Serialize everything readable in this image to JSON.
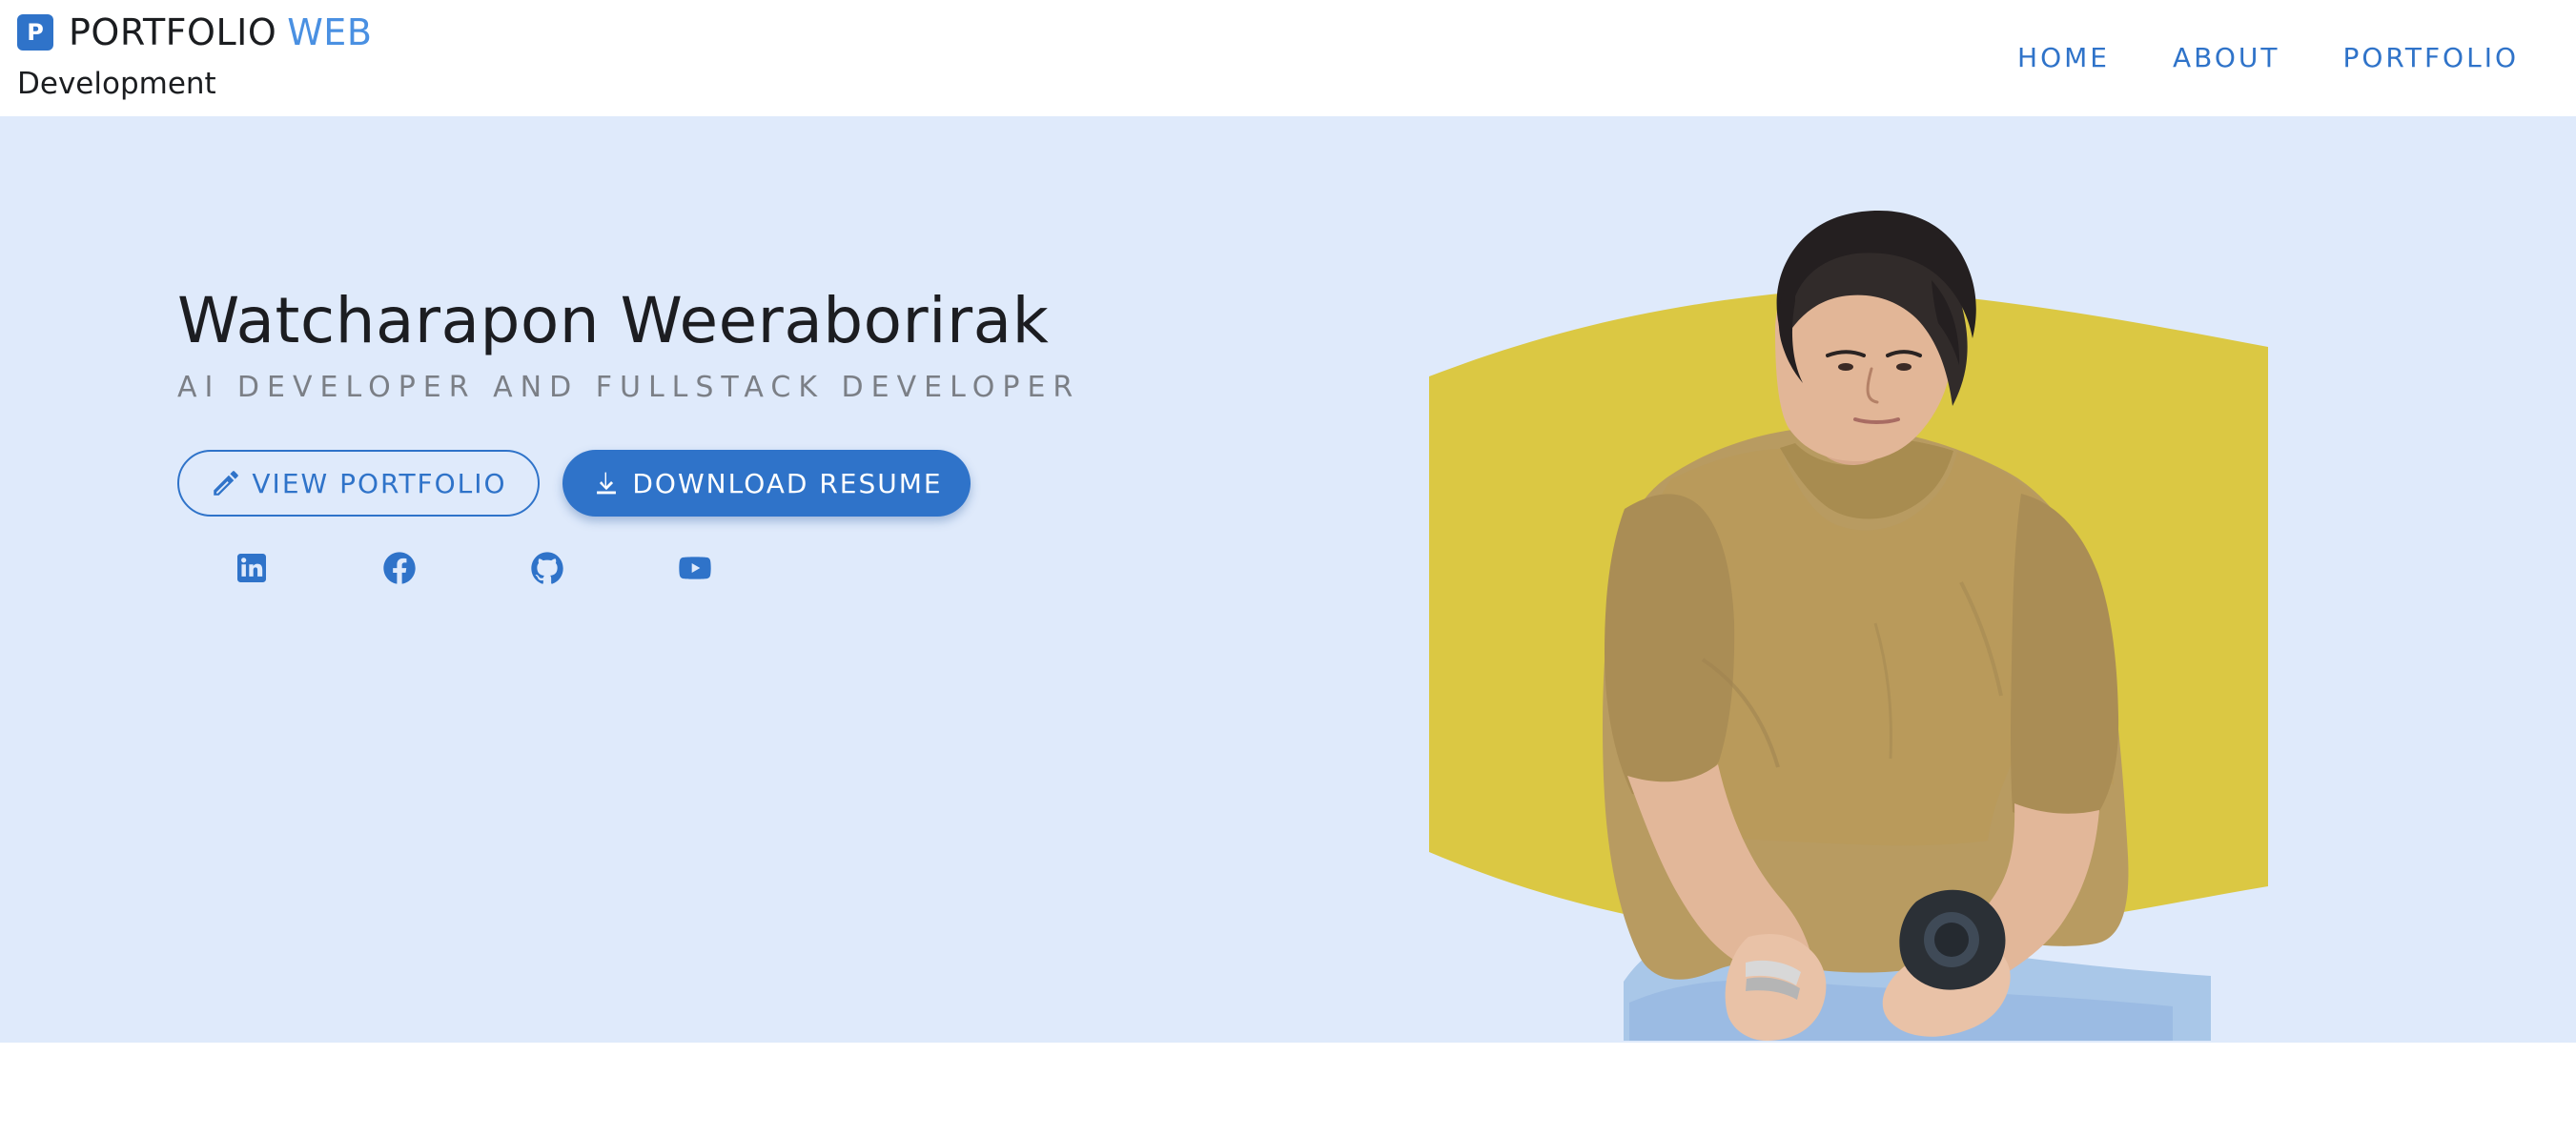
{
  "brand": {
    "icon_letter": "P",
    "primary": "PORTFOLIO",
    "accent": "WEB",
    "subtitle": "Development"
  },
  "nav": {
    "items": [
      "HOME",
      "ABOUT",
      "PORTFOLIO"
    ]
  },
  "hero": {
    "name": "Watcharapon Weeraborirak",
    "tagline": "AI DEVELOPER AND FULLSTACK DEVELOPER",
    "buttons": {
      "view_portfolio": "VIEW PORTFOLIO",
      "download_resume": "DOWNLOAD RESUME"
    },
    "social": [
      {
        "name": "linkedin-icon"
      },
      {
        "name": "facebook-icon"
      },
      {
        "name": "github-icon"
      },
      {
        "name": "youtube-icon"
      }
    ],
    "image_description": "person-sitting-on-stool"
  },
  "colors": {
    "primary": "#2f73c9",
    "accent": "#4a90e2",
    "hero_background": "#dfeafb",
    "blob": "#dbc843",
    "text": "#1b1d20",
    "muted": "#7b7f86"
  }
}
